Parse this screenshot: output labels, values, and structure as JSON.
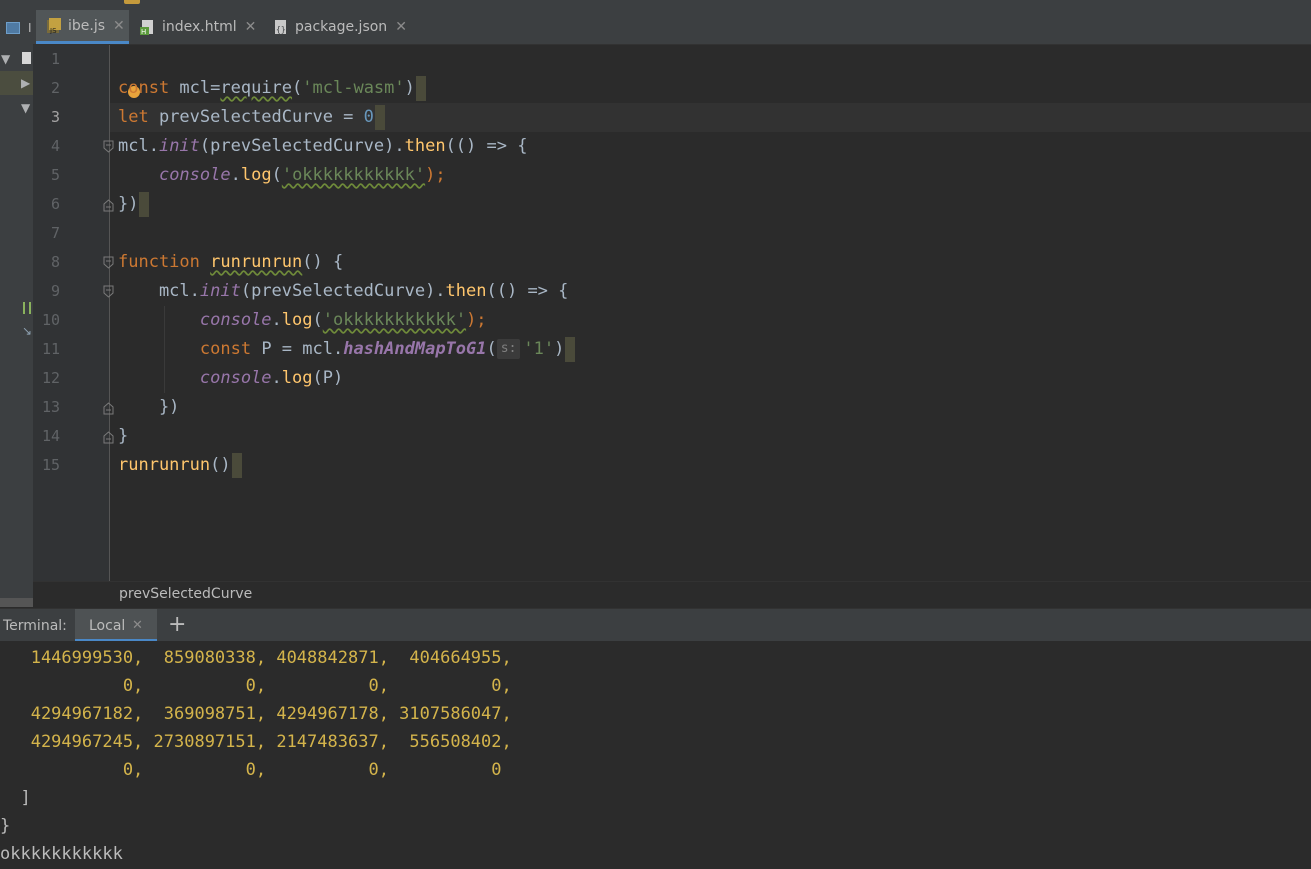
{
  "tabs": [
    {
      "label": "ibe.js",
      "icon": "js-file-icon",
      "active": true
    },
    {
      "label": "index.html",
      "icon": "html-file-icon",
      "active": false
    },
    {
      "label": "package.json",
      "icon": "json-file-icon",
      "active": false
    }
  ],
  "sidebar": {
    "label_fragment": "I"
  },
  "editor": {
    "line_numbers": [
      "1",
      "2",
      "3",
      "4",
      "5",
      "6",
      "7",
      "8",
      "9",
      "10",
      "11",
      "12",
      "13",
      "14",
      "15"
    ],
    "current_line": 3,
    "tokens": {
      "l2": [
        "const",
        " mcl=",
        "require",
        "(",
        "'mcl-wasm'",
        ")"
      ],
      "l3": [
        "let",
        " prevSelectedCurve = ",
        "0"
      ],
      "l4": [
        "mcl.",
        "init",
        "(prevSelectedCurve).",
        "then",
        "(() => {"
      ],
      "l5": [
        "    ",
        "console",
        ".",
        "log",
        "(",
        "'okkkkkkkkkkk'",
        ");"
      ],
      "l6": [
        "})"
      ],
      "l8": [
        "function",
        " ",
        "runrunrun",
        "() {"
      ],
      "l9": [
        "    mcl.",
        "init",
        "(prevSelectedCurve).",
        "then",
        "(() => {"
      ],
      "l10": [
        "        ",
        "console",
        ".",
        "log",
        "(",
        "'okkkkkkkkkkk'",
        ");"
      ],
      "l11": [
        "        ",
        "const",
        " P = mcl.",
        "hashAndMapToG1",
        "(",
        "s:",
        "'1'",
        ")"
      ],
      "l12": [
        "        ",
        "console",
        ".",
        "log",
        "(P)"
      ],
      "l13": [
        "    })"
      ],
      "l14": [
        "}"
      ],
      "l15": [
        "runrunrun",
        "()"
      ]
    }
  },
  "breadcrumb": "prevSelectedCurve",
  "terminal": {
    "title": "Terminal:",
    "tab_label": "Local",
    "lines": [
      "   1446999530,  859080338, 4048842871,  404664955,",
      "            0,          0,          0,          0,",
      "   4294967182,  369098751, 4294967178, 3107586047,",
      "   4294967245, 2730897151, 2147483637,  556508402,",
      "            0,          0,          0,          0",
      "  ]",
      "}",
      "okkkkkkkkkkk"
    ]
  },
  "colors": {
    "keyword": "#cc7832",
    "string": "#6a8759",
    "number": "#6897bb",
    "function": "#ffc66d",
    "italic_member": "#9876aa",
    "terminal_numbers": "#d4b44b",
    "accent": "#4a88c7"
  }
}
